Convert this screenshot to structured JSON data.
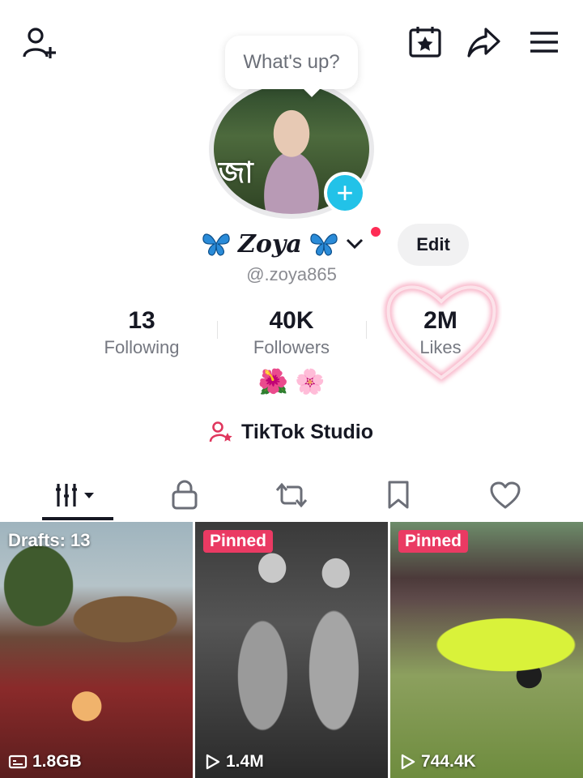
{
  "topbar": {
    "add_friend_icon": "person-plus-icon",
    "calendar_icon": "calendar-star-icon",
    "share_icon": "share-arrow-icon",
    "menu_icon": "hamburger-menu-icon"
  },
  "status_bubble": {
    "text": "What's up?"
  },
  "avatar": {
    "overlay_text": "জা ",
    "add_icon": "plus-icon"
  },
  "profile": {
    "display_name": "Zoya",
    "handle": "@.zoya865",
    "edit_label": "Edit",
    "bio_emojis": "🌺 🌸"
  },
  "stats": [
    {
      "value": "13",
      "label": "Following"
    },
    {
      "value": "40K",
      "label": "Followers"
    },
    {
      "value": "2M",
      "label": "Likes"
    }
  ],
  "studio": {
    "label": "TikTok Studio"
  },
  "tabs": [
    "videos-grid-icon",
    "lock-icon",
    "repost-icon",
    "bookmark-icon",
    "heart-icon"
  ],
  "grid": [
    {
      "label": "Drafts: 13",
      "footer": "1.8GB",
      "footer_icon": "storage-icon"
    },
    {
      "label": "Pinned",
      "footer": "1.4M",
      "footer_icon": "play-icon"
    },
    {
      "label": "Pinned",
      "footer": "744.4K",
      "footer_icon": "play-icon"
    }
  ],
  "colors": {
    "accent": "#fe2c55",
    "pinned": "#ea3a63",
    "add_button": "#22c2e8"
  }
}
